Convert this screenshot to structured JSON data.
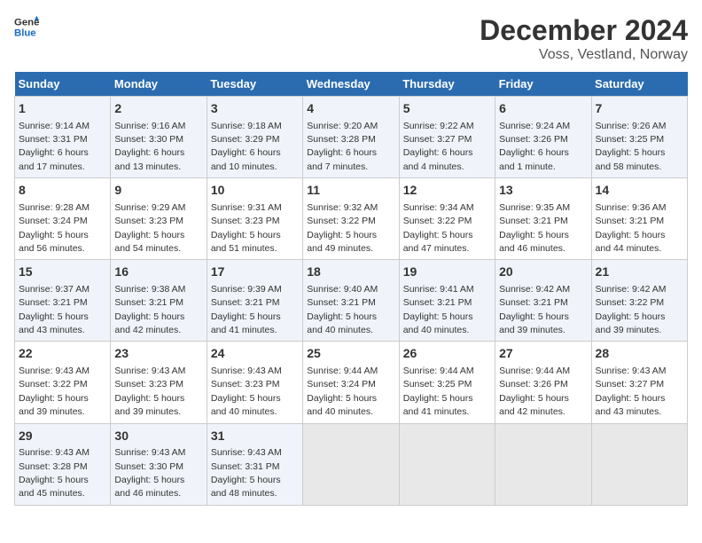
{
  "logo": {
    "line1": "General",
    "line2": "Blue"
  },
  "title": "December 2024",
  "subtitle": "Voss, Vestland, Norway",
  "days_of_week": [
    "Sunday",
    "Monday",
    "Tuesday",
    "Wednesday",
    "Thursday",
    "Friday",
    "Saturday"
  ],
  "weeks": [
    [
      {
        "day": "1",
        "info": "Sunrise: 9:14 AM\nSunset: 3:31 PM\nDaylight: 6 hours\nand 17 minutes."
      },
      {
        "day": "2",
        "info": "Sunrise: 9:16 AM\nSunset: 3:30 PM\nDaylight: 6 hours\nand 13 minutes."
      },
      {
        "day": "3",
        "info": "Sunrise: 9:18 AM\nSunset: 3:29 PM\nDaylight: 6 hours\nand 10 minutes."
      },
      {
        "day": "4",
        "info": "Sunrise: 9:20 AM\nSunset: 3:28 PM\nDaylight: 6 hours\nand 7 minutes."
      },
      {
        "day": "5",
        "info": "Sunrise: 9:22 AM\nSunset: 3:27 PM\nDaylight: 6 hours\nand 4 minutes."
      },
      {
        "day": "6",
        "info": "Sunrise: 9:24 AM\nSunset: 3:26 PM\nDaylight: 6 hours\nand 1 minute."
      },
      {
        "day": "7",
        "info": "Sunrise: 9:26 AM\nSunset: 3:25 PM\nDaylight: 5 hours\nand 58 minutes."
      }
    ],
    [
      {
        "day": "8",
        "info": "Sunrise: 9:28 AM\nSunset: 3:24 PM\nDaylight: 5 hours\nand 56 minutes."
      },
      {
        "day": "9",
        "info": "Sunrise: 9:29 AM\nSunset: 3:23 PM\nDaylight: 5 hours\nand 54 minutes."
      },
      {
        "day": "10",
        "info": "Sunrise: 9:31 AM\nSunset: 3:23 PM\nDaylight: 5 hours\nand 51 minutes."
      },
      {
        "day": "11",
        "info": "Sunrise: 9:32 AM\nSunset: 3:22 PM\nDaylight: 5 hours\nand 49 minutes."
      },
      {
        "day": "12",
        "info": "Sunrise: 9:34 AM\nSunset: 3:22 PM\nDaylight: 5 hours\nand 47 minutes."
      },
      {
        "day": "13",
        "info": "Sunrise: 9:35 AM\nSunset: 3:21 PM\nDaylight: 5 hours\nand 46 minutes."
      },
      {
        "day": "14",
        "info": "Sunrise: 9:36 AM\nSunset: 3:21 PM\nDaylight: 5 hours\nand 44 minutes."
      }
    ],
    [
      {
        "day": "15",
        "info": "Sunrise: 9:37 AM\nSunset: 3:21 PM\nDaylight: 5 hours\nand 43 minutes."
      },
      {
        "day": "16",
        "info": "Sunrise: 9:38 AM\nSunset: 3:21 PM\nDaylight: 5 hours\nand 42 minutes."
      },
      {
        "day": "17",
        "info": "Sunrise: 9:39 AM\nSunset: 3:21 PM\nDaylight: 5 hours\nand 41 minutes."
      },
      {
        "day": "18",
        "info": "Sunrise: 9:40 AM\nSunset: 3:21 PM\nDaylight: 5 hours\nand 40 minutes."
      },
      {
        "day": "19",
        "info": "Sunrise: 9:41 AM\nSunset: 3:21 PM\nDaylight: 5 hours\nand 40 minutes."
      },
      {
        "day": "20",
        "info": "Sunrise: 9:42 AM\nSunset: 3:21 PM\nDaylight: 5 hours\nand 39 minutes."
      },
      {
        "day": "21",
        "info": "Sunrise: 9:42 AM\nSunset: 3:22 PM\nDaylight: 5 hours\nand 39 minutes."
      }
    ],
    [
      {
        "day": "22",
        "info": "Sunrise: 9:43 AM\nSunset: 3:22 PM\nDaylight: 5 hours\nand 39 minutes."
      },
      {
        "day": "23",
        "info": "Sunrise: 9:43 AM\nSunset: 3:23 PM\nDaylight: 5 hours\nand 39 minutes."
      },
      {
        "day": "24",
        "info": "Sunrise: 9:43 AM\nSunset: 3:23 PM\nDaylight: 5 hours\nand 40 minutes."
      },
      {
        "day": "25",
        "info": "Sunrise: 9:44 AM\nSunset: 3:24 PM\nDaylight: 5 hours\nand 40 minutes."
      },
      {
        "day": "26",
        "info": "Sunrise: 9:44 AM\nSunset: 3:25 PM\nDaylight: 5 hours\nand 41 minutes."
      },
      {
        "day": "27",
        "info": "Sunrise: 9:44 AM\nSunset: 3:26 PM\nDaylight: 5 hours\nand 42 minutes."
      },
      {
        "day": "28",
        "info": "Sunrise: 9:43 AM\nSunset: 3:27 PM\nDaylight: 5 hours\nand 43 minutes."
      }
    ],
    [
      {
        "day": "29",
        "info": "Sunrise: 9:43 AM\nSunset: 3:28 PM\nDaylight: 5 hours\nand 45 minutes."
      },
      {
        "day": "30",
        "info": "Sunrise: 9:43 AM\nSunset: 3:30 PM\nDaylight: 5 hours\nand 46 minutes."
      },
      {
        "day": "31",
        "info": "Sunrise: 9:43 AM\nSunset: 3:31 PM\nDaylight: 5 hours\nand 48 minutes."
      },
      {
        "day": "",
        "info": ""
      },
      {
        "day": "",
        "info": ""
      },
      {
        "day": "",
        "info": ""
      },
      {
        "day": "",
        "info": ""
      }
    ]
  ]
}
